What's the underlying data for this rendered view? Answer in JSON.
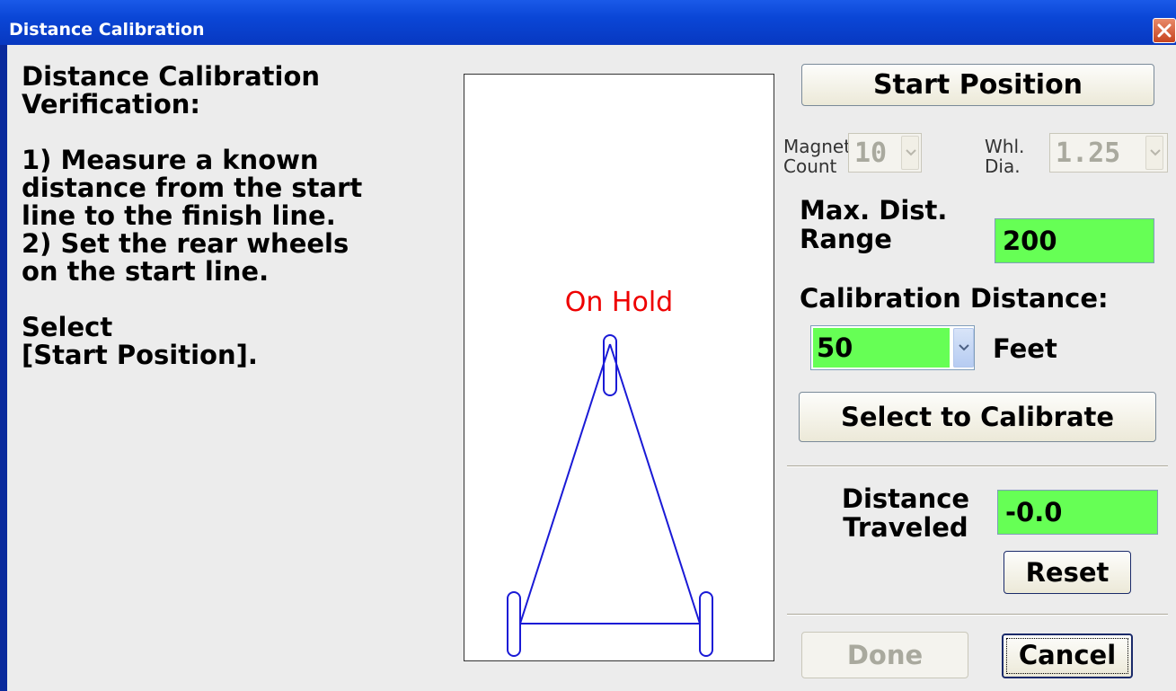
{
  "window": {
    "title": "Distance Calibration",
    "close_glyph": "✕"
  },
  "instructions": {
    "text": "Distance Calibration\nVerification:\n\n1) Measure a known\ndistance from the start\nline to the finish line.\n2) Set the rear wheels\non the start line.\n\nSelect\n[Start Position]."
  },
  "canvas": {
    "status": "On Hold",
    "status_color": "#ee0000",
    "drawing_color": "#1a1ad6"
  },
  "controls": {
    "start_position_label": "Start Position",
    "magnet_count_label": "Magnet\nCount",
    "magnet_count_value": "10",
    "wheel_dia_label": "Whl.\nDia.",
    "wheel_dia_value": "1.25",
    "max_dist_label": "Max. Dist.\nRange",
    "max_dist_value": "200",
    "calibration_distance_label": "Calibration Distance:",
    "calibration_distance_value": "50",
    "unit_label": "Feet",
    "select_to_calibrate_label": "Select to Calibrate",
    "distance_traveled_label": "Distance\nTraveled",
    "distance_traveled_value": "-0.0",
    "reset_label": "Reset",
    "done_label": "Done",
    "cancel_label": "Cancel"
  },
  "colors": {
    "field_green": "#66ff55",
    "titlebar_blue": "#0a46d6"
  }
}
